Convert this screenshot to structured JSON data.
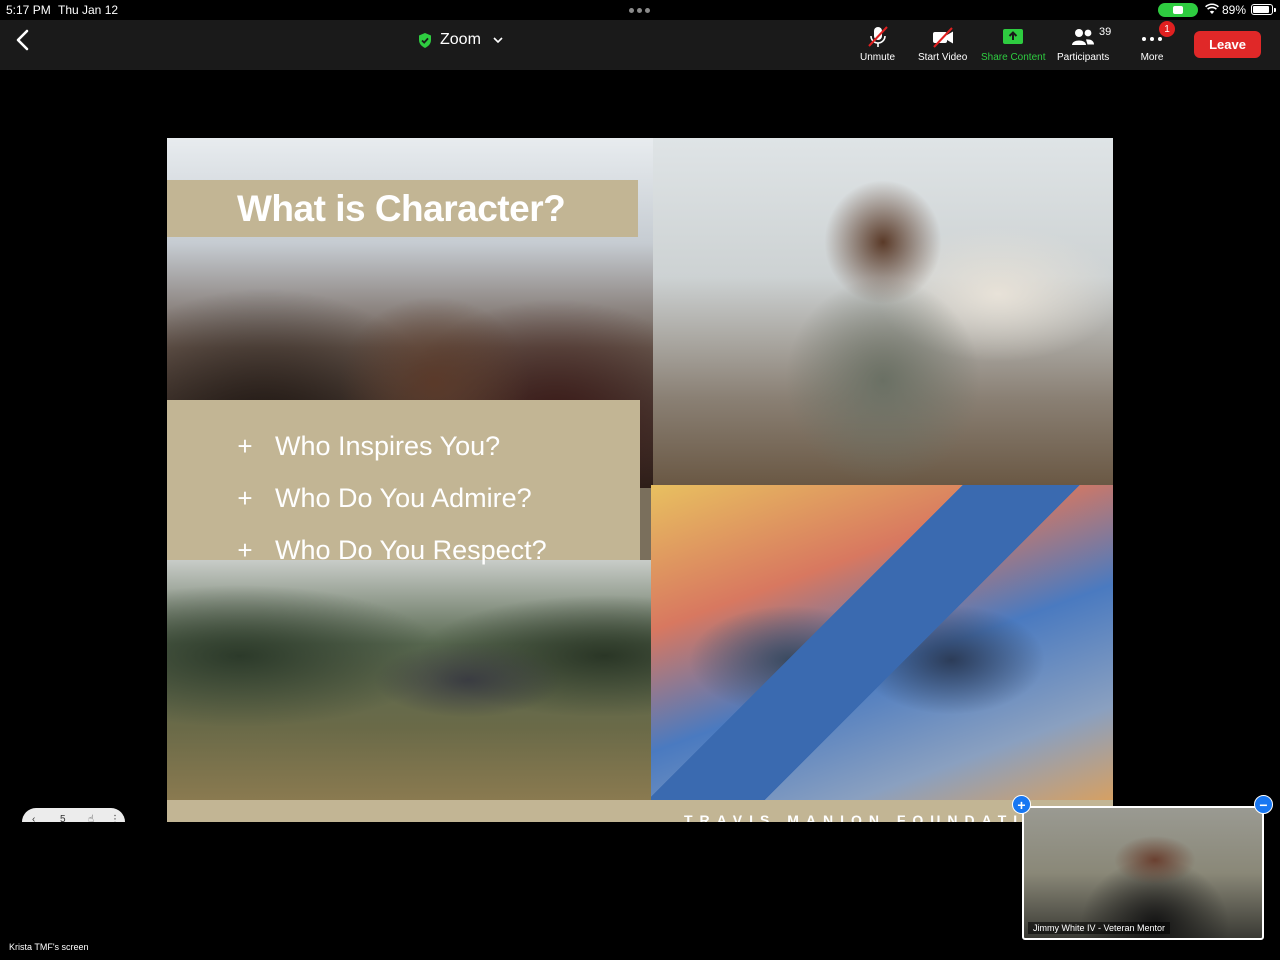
{
  "status_bar": {
    "time": "5:17 PM",
    "date": "Thu Jan 12",
    "battery_percent": "89%",
    "battery_level": 0.89,
    "camera_indicator_color": "#2ecc40"
  },
  "toolbar": {
    "meeting_title": "Zoom",
    "security_icon": "shield-check-icon",
    "buttons": {
      "unmute": "Unmute",
      "start_video": "Start Video",
      "share_content": "Share Content",
      "participants": "Participants",
      "more": "More"
    },
    "participants_count": "39",
    "more_badge": "1",
    "leave_label": "Leave",
    "leave_color": "#e02828",
    "share_color": "#2ecc40"
  },
  "slide": {
    "title": "What is Character?",
    "questions": [
      {
        "marker": "+",
        "text": "Who Inspires You?"
      },
      {
        "marker": "+",
        "text": "Who Do You Admire?"
      },
      {
        "marker": "+",
        "text": "Who Do You Respect?"
      }
    ],
    "footer_text": "TRAVIS MANION FOUNDATIO",
    "band_color": "#c2b594"
  },
  "page_navigator": {
    "left": "‹",
    "page": "5",
    "hand_icon": "hand-pointer-icon",
    "menu": "⋮"
  },
  "thumbnail": {
    "name": "Jimmy White IV - Veteran Mentor",
    "add_symbol": "+",
    "minimize_symbol": "−"
  },
  "screen_owner": "Krista TMF's screen"
}
